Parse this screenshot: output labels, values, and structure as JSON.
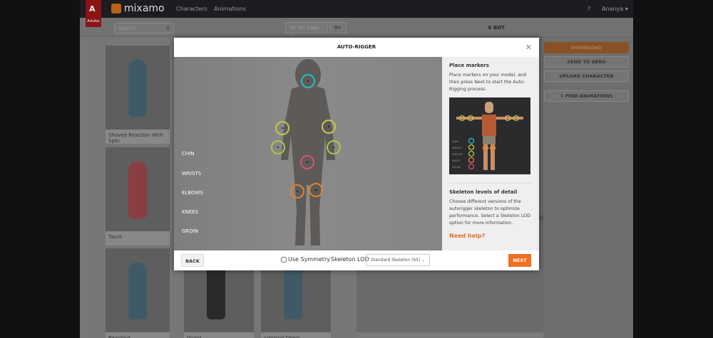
{
  "header": {
    "brand": "mixamo",
    "adobe_label": "Adobe",
    "nav": [
      "Characters",
      "Animations"
    ],
    "user": "Ananya"
  },
  "toolbar": {
    "search_placeholder": "Search",
    "per_page": "48 Per page",
    "character_name": "X BOT"
  },
  "cards": [
    {
      "label": "Shoved Reaction With Spin",
      "color": "#3f5a66"
    },
    {
      "label": "Taunt",
      "color": "#8a3e44"
    },
    {
      "label": "Reacting",
      "color": "#3f5a66"
    },
    {
      "label": "Dying",
      "color": "#2a2a2a"
    },
    {
      "label": "Jumping Down",
      "color": "#3f5a66"
    }
  ],
  "side_buttons": {
    "download": "DOWNLOAD",
    "send": "SEND TO AERO",
    "upload": "UPLOAD CHARACTER",
    "find": "FIND ANIMATIONS"
  },
  "modal": {
    "title": "AUTO-RIGGER",
    "labels": [
      "CHIN",
      "WRISTS",
      "ELBOWS",
      "KNEES",
      "GROIN"
    ],
    "marker_colors": {
      "chin": "#2bbfc0",
      "wrists": "#c9c64a",
      "elbows": "#a9c845",
      "knees": "#e2832e",
      "groin": "#d9507a"
    },
    "panel": {
      "place_title": "Place markers",
      "place_text": "Place markers on your model, and then press Next to start the Auto-Rigging process.",
      "preview_labels": [
        "CHIN",
        "WRISTS",
        "ELBOWS",
        "KNEES",
        "GROIN"
      ],
      "lod_title": "Skeleton levels of detail",
      "lod_text": "Choose different versions of the autorigger skeleton to optimize performance. Select a Skeleton LOD option for more information.",
      "help": "Need help?"
    },
    "footer": {
      "back": "BACK",
      "symmetry": "Use Symmetry",
      "symmetry_checked": false,
      "lod_label": "Skeleton LOD",
      "lod_value": "Standard Skeleton (65)",
      "next": "NEXT"
    }
  },
  "accent": "#f26f21"
}
